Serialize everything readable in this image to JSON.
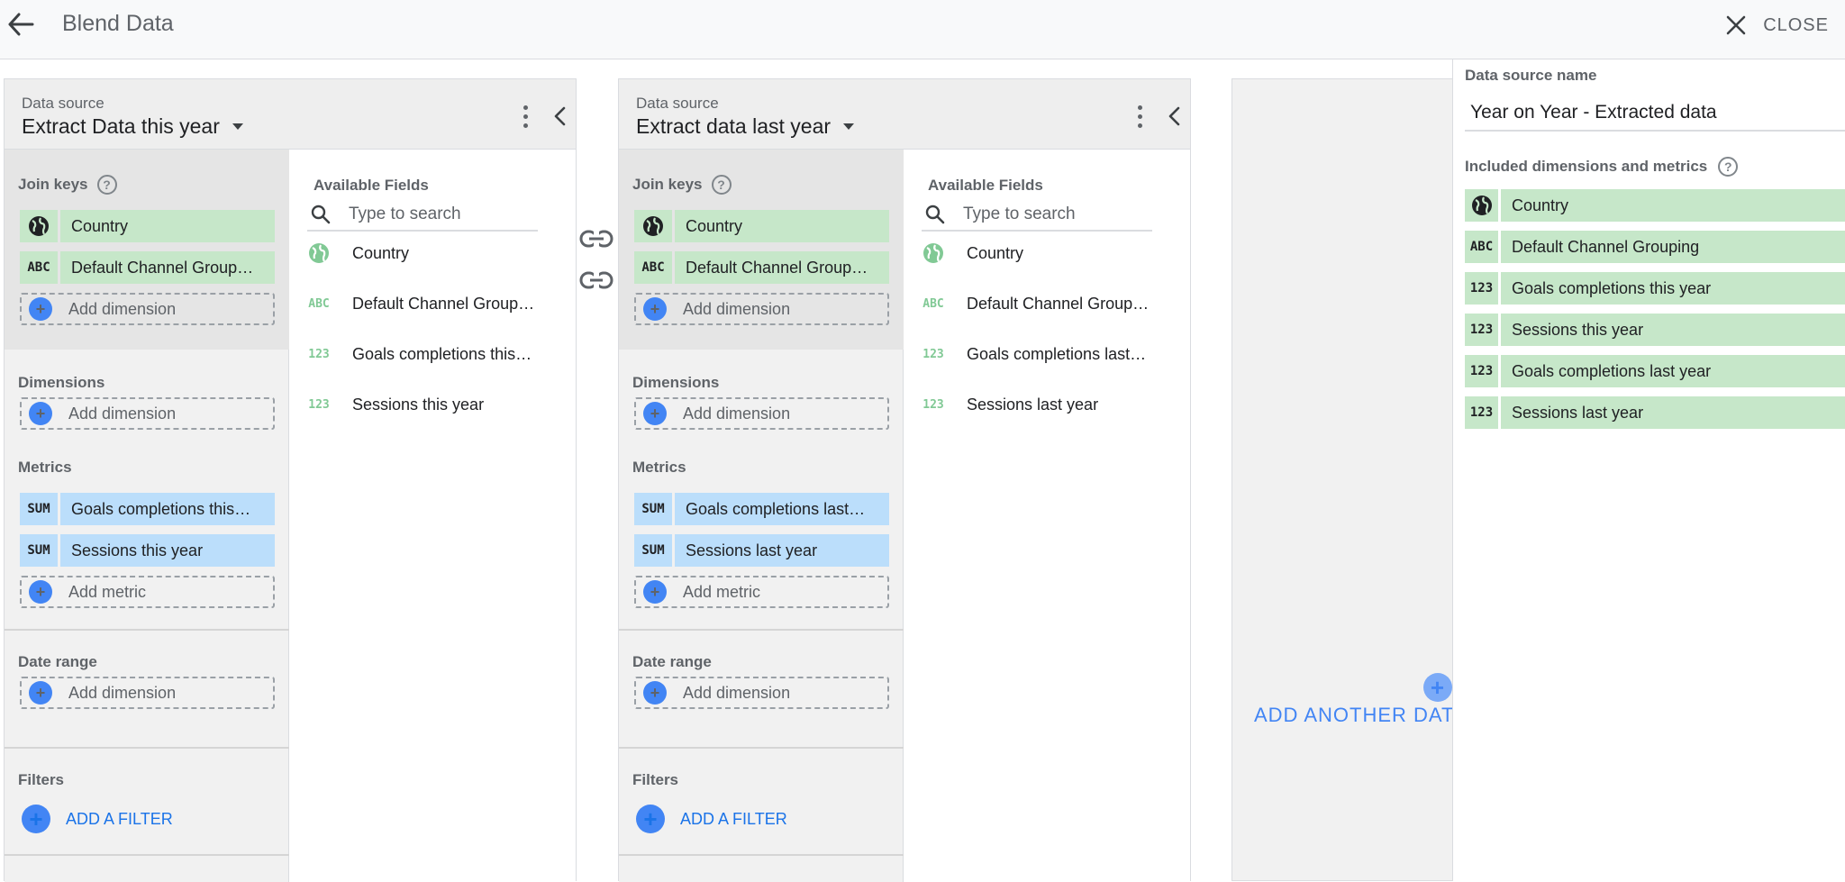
{
  "header": {
    "title": "Blend Data",
    "close_label": "CLOSE"
  },
  "panels": [
    {
      "ds_label": "Data source",
      "ds_name": "Extract Data this year",
      "join_keys_title": "Join keys",
      "join_keys": [
        {
          "icon": "globe-icon",
          "label": "Country"
        },
        {
          "icon": "abc-icon",
          "icon_text": "ABC",
          "label": "Default Channel Group…"
        }
      ],
      "add_dimension": "Add dimension",
      "dimensions_title": "Dimensions",
      "metrics_title": "Metrics",
      "metrics": [
        {
          "icon_text": "SUM",
          "label": "Goals completions this…"
        },
        {
          "icon_text": "SUM",
          "label": "Sessions this year"
        }
      ],
      "add_metric": "Add metric",
      "date_range_title": "Date range",
      "filters_title": "Filters",
      "add_filter": "ADD A FILTER",
      "available_fields_title": "Available Fields",
      "search_placeholder": "Type to search",
      "fields": [
        {
          "icon": "globe-icon",
          "label": "Country"
        },
        {
          "icon": "abc-icon",
          "icon_text": "ABC",
          "label": "Default Channel Group…"
        },
        {
          "icon": "number-icon",
          "icon_text": "123",
          "label": "Goals completions this…"
        },
        {
          "icon": "number-icon",
          "icon_text": "123",
          "label": "Sessions this year"
        }
      ]
    },
    {
      "ds_label": "Data source",
      "ds_name": "Extract data last year",
      "join_keys_title": "Join keys",
      "join_keys": [
        {
          "icon": "globe-icon",
          "label": "Country"
        },
        {
          "icon": "abc-icon",
          "icon_text": "ABC",
          "label": "Default Channel Group…"
        }
      ],
      "add_dimension": "Add dimension",
      "dimensions_title": "Dimensions",
      "metrics_title": "Metrics",
      "metrics": [
        {
          "icon_text": "SUM",
          "label": "Goals completions last…"
        },
        {
          "icon_text": "SUM",
          "label": "Sessions last year"
        }
      ],
      "add_metric": "Add metric",
      "date_range_title": "Date range",
      "filters_title": "Filters",
      "add_filter": "ADD A FILTER",
      "available_fields_title": "Available Fields",
      "search_placeholder": "Type to search",
      "fields": [
        {
          "icon": "globe-icon",
          "label": "Country"
        },
        {
          "icon": "abc-icon",
          "icon_text": "ABC",
          "label": "Default Channel Group…"
        },
        {
          "icon": "number-icon",
          "icon_text": "123",
          "label": "Goals completions last…"
        },
        {
          "icon": "number-icon",
          "icon_text": "123",
          "label": "Sessions last year"
        }
      ]
    }
  ],
  "add_another": {
    "label": "ADD ANOTHER DATA"
  },
  "summary": {
    "name_label": "Data source name",
    "name_value": "Year on Year - Extracted data",
    "included_title": "Included dimensions and metrics",
    "included": [
      {
        "icon": "globe-icon",
        "label": "Country"
      },
      {
        "icon": "abc-icon",
        "icon_text": "ABC",
        "label": "Default Channel Grouping"
      },
      {
        "icon": "number-icon",
        "icon_text": "123",
        "label": "Goals completions this year"
      },
      {
        "icon": "number-icon",
        "icon_text": "123",
        "label": "Sessions this year"
      },
      {
        "icon": "number-icon",
        "icon_text": "123",
        "label": "Goals completions last year"
      },
      {
        "icon": "number-icon",
        "icon_text": "123",
        "label": "Sessions last year"
      }
    ]
  },
  "colors": {
    "dimension_chip": "#c6e7c9",
    "metric_chip": "#bbdefb",
    "accent": "#4285f4",
    "link": "#1a73e8"
  }
}
